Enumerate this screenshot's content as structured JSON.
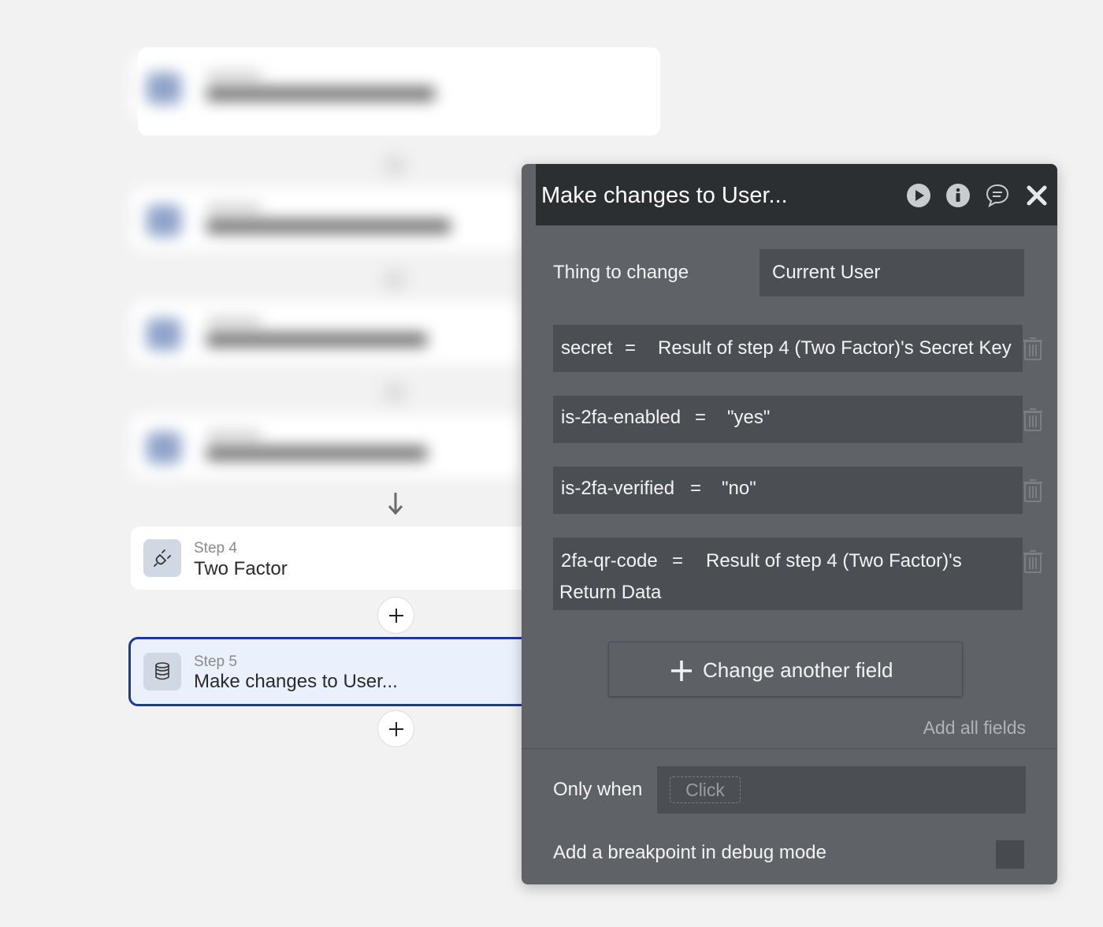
{
  "workflow": {
    "steps": [
      {
        "number_label": "Step 4",
        "title": "Two Factor",
        "icon": "plug-icon"
      },
      {
        "number_label": "Step 5",
        "title": "Make changes to User...",
        "icon": "database-icon"
      }
    ]
  },
  "panel": {
    "title": "Make changes to User...",
    "header_icons": [
      "play-icon",
      "info-icon",
      "comment-icon",
      "close-icon"
    ],
    "thing_to_change_label": "Thing to change",
    "thing_to_change_value": "Current User",
    "fields": [
      {
        "name": "secret",
        "op": "=",
        "value": "Result of step 4 (Two Factor)'s Secret Key"
      },
      {
        "name": "is-2fa-enabled",
        "op": "=",
        "value": "\"yes\""
      },
      {
        "name": "is-2fa-verified",
        "op": "=",
        "value": "\"no\""
      },
      {
        "name": "2fa-qr-code",
        "op": "=",
        "value_line1": "Result of step 4 (Two Factor)'s",
        "value_line2": "Return Data"
      }
    ],
    "change_another_label": "Change another field",
    "add_all_label": "Add all fields",
    "only_when_label": "Only when",
    "only_when_placeholder": "Click",
    "breakpoint_label": "Add a breakpoint in debug mode"
  },
  "colors": {
    "header_bg": "#2b2f31",
    "panel_bg": "#5f6368",
    "dynamic_text": "#6aaef5",
    "selected_border": "#1b3aa0"
  }
}
